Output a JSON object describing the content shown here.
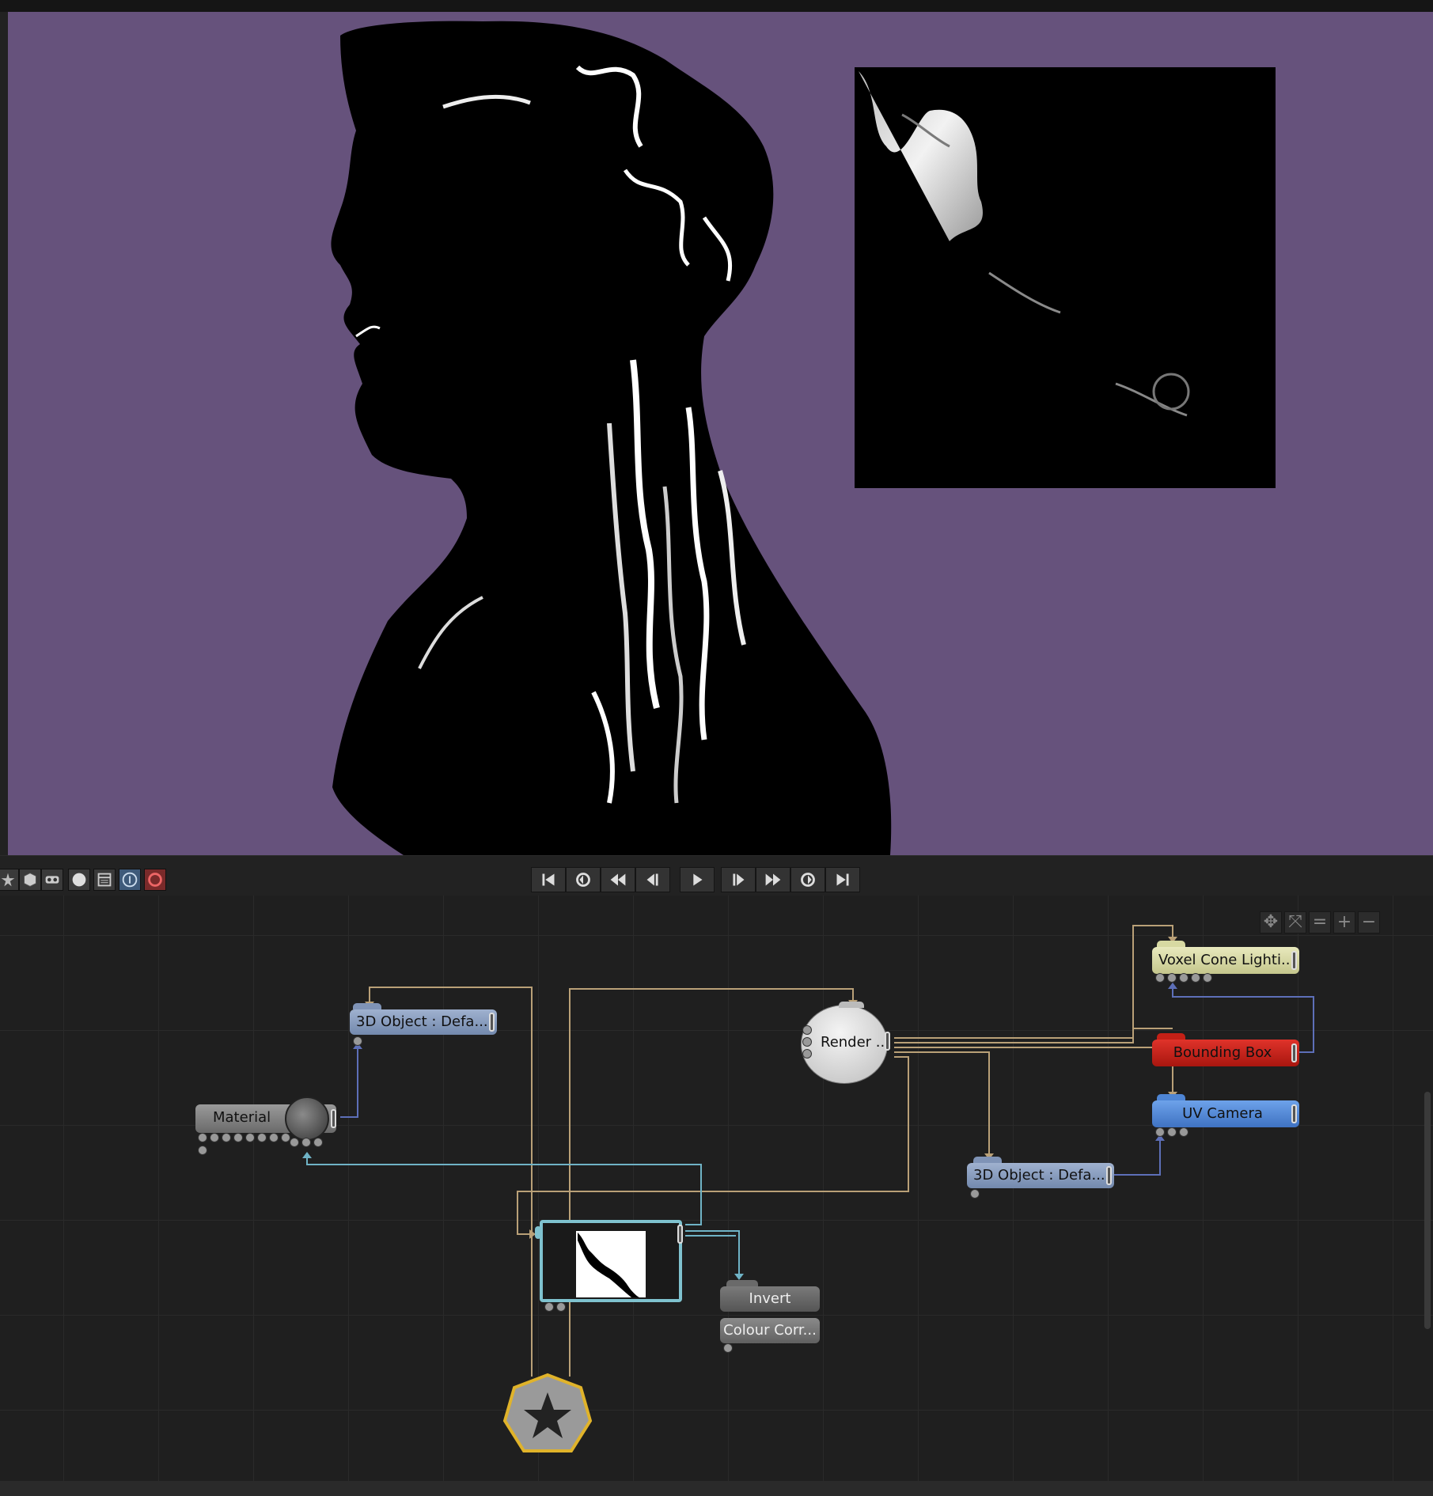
{
  "colors": {
    "viewport_bg": "#66527c",
    "node_3d_object": "#7f93b6",
    "node_voxel": "#d7d9a2",
    "node_bounding_box": "#c42016",
    "node_uv_camera": "#4e85d4",
    "node_material": "#7c7c7c",
    "node_invert": "#6a6a6a",
    "wire_tan": "#b9a077",
    "wire_blue": "#5d6fb8",
    "wire_cyan": "#6fb3c6"
  },
  "viewport_toolbar": {
    "icons": [
      "star-icon",
      "cube-icon",
      "vr-icon",
      "sphere-icon",
      "panel-icon",
      "info-icon",
      "refresh-icon"
    ]
  },
  "transport": {
    "icons": [
      "skip-to-start-icon",
      "loop-back-icon",
      "rewind-icon",
      "step-back-icon",
      "play-icon",
      "step-forward-icon",
      "fast-forward-icon",
      "loop-forward-icon",
      "skip-to-end-icon"
    ]
  },
  "graph_nav": {
    "icons": [
      "pan-icon",
      "fit-icon",
      "equal-icon",
      "zoom-in-icon",
      "zoom-out-icon"
    ],
    "equal_label": "=",
    "plus_label": "+",
    "minus_label": "−"
  },
  "nodes": {
    "object_a": "3D  Object  :  Defa...",
    "material": "Material",
    "render": "Render  ...",
    "voxel": "Voxel  Cone  Lighti...",
    "bounding_box": "Bounding  Box",
    "uv_camera": "UV  Camera",
    "object_b": "3D  Object  :  Defa...",
    "invert": "Invert",
    "colour_corr": "Colour  Corr..."
  }
}
